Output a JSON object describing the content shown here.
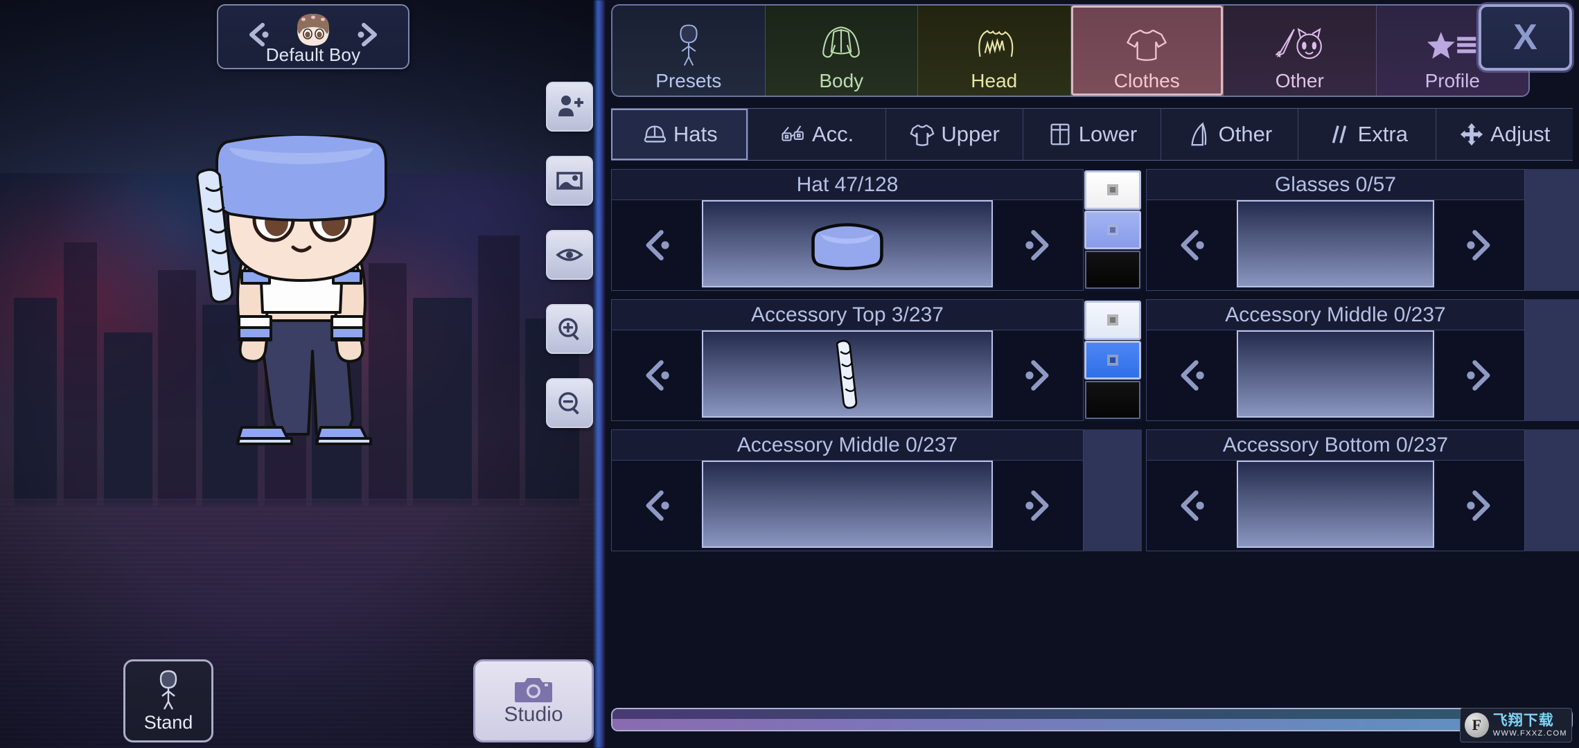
{
  "app": {
    "character_name": "Default Boy"
  },
  "categories": [
    {
      "key": "presets",
      "label": "Presets",
      "icon": "body-figure-icon",
      "active": false
    },
    {
      "key": "body",
      "label": "Body",
      "icon": "jacket-icon",
      "active": false
    },
    {
      "key": "head",
      "label": "Head",
      "icon": "hair-icon",
      "active": false
    },
    {
      "key": "clothes",
      "label": "Clothes",
      "icon": "tshirt-icon",
      "active": true
    },
    {
      "key": "other",
      "label": "Other",
      "icon": "sword-cat-icon",
      "active": false
    },
    {
      "key": "profile",
      "label": "Profile",
      "icon": "star-list-icon",
      "active": false
    }
  ],
  "close_button": {
    "label": "X"
  },
  "sub_tabs": [
    {
      "label": "Hats",
      "icon": "cap-icon",
      "active": true
    },
    {
      "label": "Acc.",
      "icon": "glasses-icon",
      "active": false
    },
    {
      "label": "Upper",
      "icon": "shirt-icon",
      "active": false
    },
    {
      "label": "Lower",
      "icon": "pants-icon",
      "active": false
    },
    {
      "label": "Other",
      "icon": "cape-icon",
      "active": false
    },
    {
      "label": "Extra",
      "icon": "slashes-icon",
      "active": false
    },
    {
      "label": "Adjust",
      "icon": "move-icon",
      "active": false
    }
  ],
  "slots": [
    {
      "title": "Hat 47/128",
      "index": 47,
      "total": 128,
      "item_icon": "blue-pillbox-hat",
      "swatches": [
        {
          "color": "#fbfbfb",
          "selected": true
        },
        {
          "color": "#95a8ee",
          "selected": true
        },
        {
          "color": "#0a0a0a",
          "selected": false
        }
      ]
    },
    {
      "title": "Glasses 0/57",
      "index": 0,
      "total": 57,
      "item_icon": "none",
      "swatches": []
    },
    {
      "title": "Accessory Top 3/237",
      "index": 3,
      "total": 237,
      "item_icon": "white-braid",
      "swatches": [
        {
          "color": "#eef1f8",
          "selected": true
        },
        {
          "color": "#3d7af0",
          "selected": true
        },
        {
          "color": "#0a0a0a",
          "selected": false
        }
      ]
    },
    {
      "title": "Accessory Middle 0/237",
      "index": 0,
      "total": 237,
      "item_icon": "none",
      "swatches": []
    },
    {
      "title": "Accessory Middle 0/237",
      "index": 0,
      "total": 237,
      "item_icon": "none",
      "swatches": []
    },
    {
      "title": "Accessory Bottom 0/237",
      "index": 0,
      "total": 237,
      "item_icon": "none",
      "swatches": []
    }
  ],
  "stage_rail": [
    {
      "icon": "add-person-icon"
    },
    {
      "icon": "image-icon"
    },
    {
      "icon": "eye-icon"
    },
    {
      "icon": "zoom-in-icon"
    },
    {
      "icon": "zoom-out-icon"
    }
  ],
  "stage_buttons": {
    "stand": {
      "label": "Stand",
      "icon": "standing-figure-icon"
    },
    "studio": {
      "label": "Studio",
      "icon": "camera-icon"
    }
  },
  "watermark": {
    "mark": "F",
    "cn": "飞翔下载",
    "url": "WWW.FXXZ.COM"
  },
  "colors": {
    "accent": "#95a8ee",
    "panel_bg": "#0d1020",
    "active_tab": "#7b4e59"
  }
}
